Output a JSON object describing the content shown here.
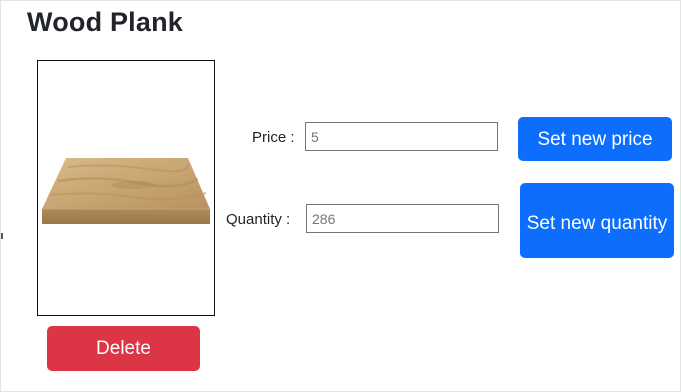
{
  "product": {
    "title": "Wood Plank",
    "image_icon": "wood-plank-image"
  },
  "price": {
    "label": "Price :",
    "value": "5",
    "button_label": "Set new price"
  },
  "quantity": {
    "label": "Quantity :",
    "value": "286",
    "button_label": "Set new quantity"
  },
  "actions": {
    "delete_label": "Delete"
  },
  "colors": {
    "primary": "#0d6efd",
    "danger": "#dc3545",
    "wood_top": "#c9a875",
    "wood_edge": "#a8875a"
  }
}
